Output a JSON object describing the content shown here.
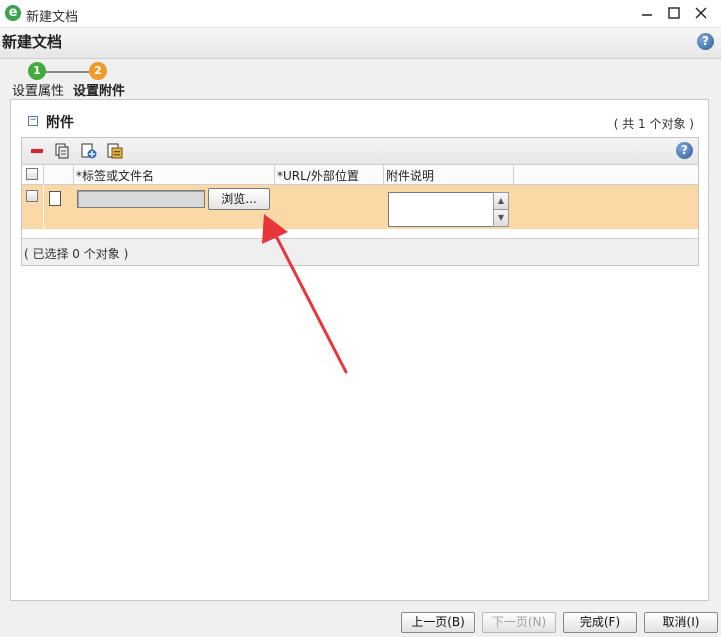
{
  "window": {
    "title": "新建文档",
    "app_icon": "e"
  },
  "header": {
    "title": "新建文档",
    "help": "?"
  },
  "wizard": {
    "steps": [
      {
        "number": "1",
        "label": "设置属性",
        "color": "#43ac3a"
      },
      {
        "number": "2",
        "label": "设置附件",
        "color": "#f19a2a"
      }
    ]
  },
  "section": {
    "toggle": "−",
    "title": "附件",
    "count_text": "( 共 1 个对象 )"
  },
  "toolbar": {
    "icons": [
      "remove-icon",
      "copy-icon",
      "add-link-icon",
      "add-file-icon",
      "help-icon"
    ],
    "help": "?"
  },
  "table": {
    "columns": [
      "*标签或文件名",
      "*URL/外部位置",
      "附件说明"
    ],
    "rows": [
      {
        "file_value": "",
        "browse_label": "浏览...",
        "url_value": "",
        "description": ""
      }
    ],
    "status": "( 已选择 0 个对象 )"
  },
  "footer": {
    "prev": "上一页(B)",
    "next": "下一页(N)",
    "finish": "完成(F)",
    "cancel": "取消(I)"
  },
  "colors": {
    "row_highlight": "#fbd9a6",
    "annotation_arrow": "#e8353a"
  }
}
